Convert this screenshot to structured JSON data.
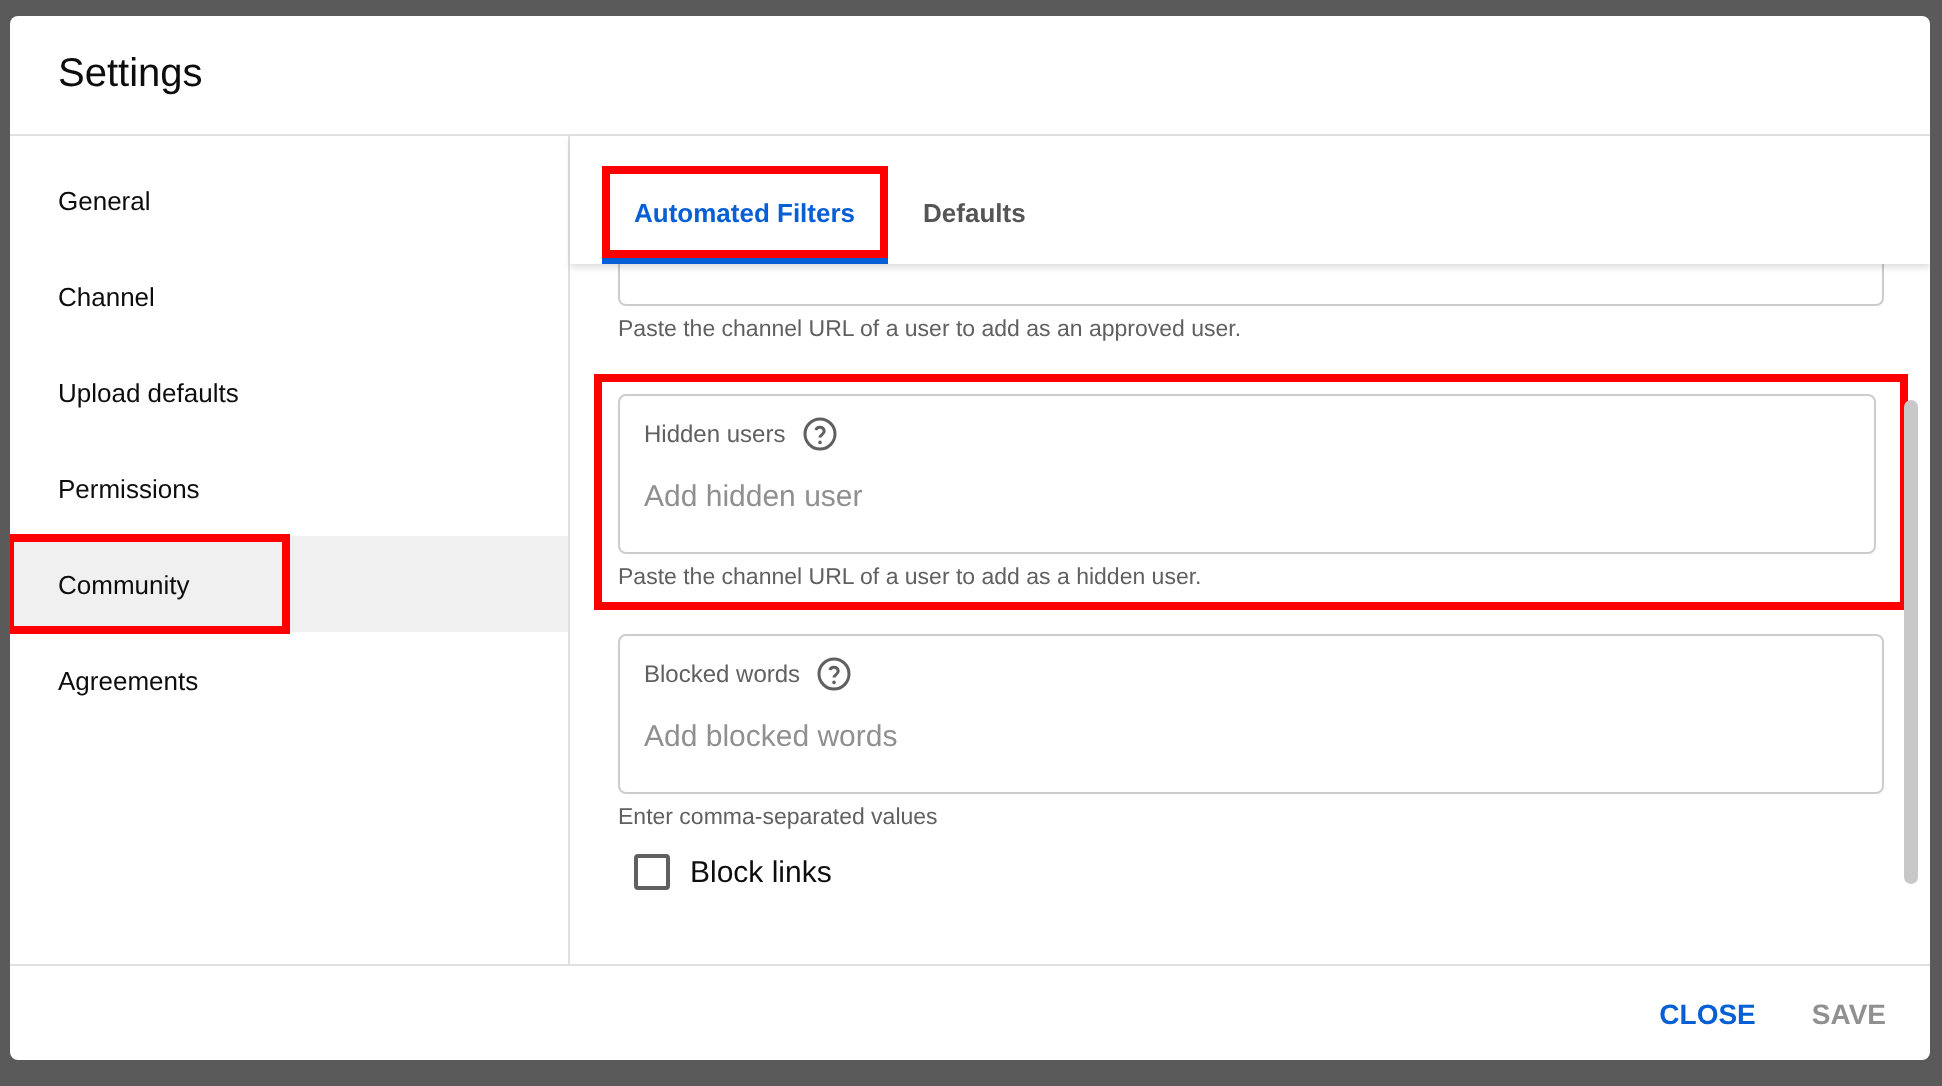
{
  "dialog": {
    "title": "Settings"
  },
  "sidebar": {
    "items": [
      {
        "label": "General",
        "selected": false,
        "highlighted": false
      },
      {
        "label": "Channel",
        "selected": false,
        "highlighted": false
      },
      {
        "label": "Upload defaults",
        "selected": false,
        "highlighted": false
      },
      {
        "label": "Permissions",
        "selected": false,
        "highlighted": false
      },
      {
        "label": "Community",
        "selected": true,
        "highlighted": true
      },
      {
        "label": "Agreements",
        "selected": false,
        "highlighted": false
      }
    ]
  },
  "tabs": [
    {
      "label": "Automated Filters",
      "selected": true,
      "highlighted": true
    },
    {
      "label": "Defaults",
      "selected": false,
      "highlighted": false
    }
  ],
  "fields": [
    {
      "kind": "clipped",
      "helper": "Paste the channel URL of a user to add as an approved user.",
      "highlighted": false
    },
    {
      "kind": "full",
      "label": "Hidden users",
      "placeholder": "Add hidden user",
      "helper": "Paste the channel URL of a user to add as a hidden user.",
      "highlighted": true
    },
    {
      "kind": "full",
      "label": "Blocked words",
      "placeholder": "Add blocked words",
      "helper": "Enter comma-separated values",
      "highlighted": false
    }
  ],
  "checkboxes": [
    {
      "label": "Block links",
      "checked": false
    }
  ],
  "footer": {
    "buttons": [
      {
        "label": "CLOSE",
        "disabled": false
      },
      {
        "label": "SAVE",
        "disabled": true
      }
    ]
  }
}
